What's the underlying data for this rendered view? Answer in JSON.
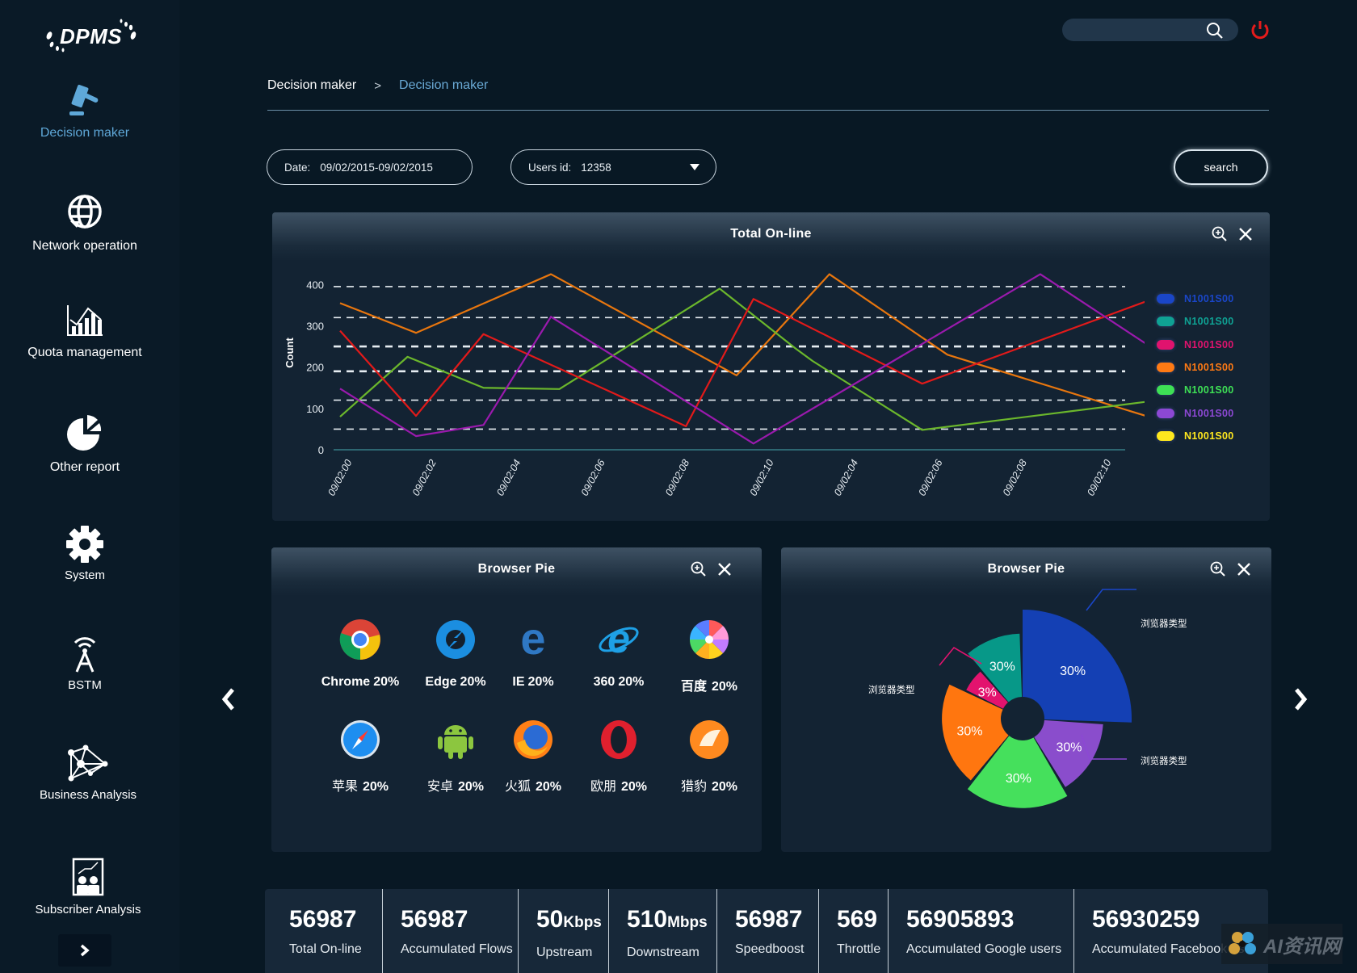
{
  "app": {
    "logo": "DPMS"
  },
  "sidebar": {
    "items": [
      {
        "label": "Decision maker",
        "icon": "gavel-icon",
        "active": true
      },
      {
        "label": "Network operation",
        "icon": "globe-refresh-icon"
      },
      {
        "label": "Quota management",
        "icon": "bar-chart-trend-icon"
      },
      {
        "label": "Other report",
        "icon": "pie-chart-icon"
      },
      {
        "label": "System",
        "icon": "gear-icon"
      },
      {
        "label": "BSTM",
        "icon": "antenna-tower-icon"
      },
      {
        "label": "Business Analysis",
        "icon": "network-graph-icon"
      },
      {
        "label": "Subscriber Analysis",
        "icon": "presentation-users-icon"
      }
    ],
    "more_icon": "chevron-right-icon"
  },
  "header": {
    "search_placeholder": "",
    "search_icon": "search-icon",
    "power_icon": "power-icon"
  },
  "breadcrumb": {
    "parent": "Decision maker",
    "separator": ">",
    "current": "Decision maker"
  },
  "filters": {
    "date_label": "Date:",
    "date_value": "09/02/2015-09/02/2015",
    "user_label": "Users id:",
    "user_value": "12358",
    "search_button": "search"
  },
  "line_panel": {
    "title": "Total On-line",
    "zoom_icon": "zoom-in-icon",
    "close_icon": "close-icon"
  },
  "pie_left": {
    "title": "Browser Pie",
    "browsers": [
      {
        "name": "Chrome",
        "pct": "20%",
        "icon": "chrome-icon"
      },
      {
        "name": "Edge",
        "pct": "20%",
        "icon": "edge-icon"
      },
      {
        "name": "IE",
        "pct": "20%",
        "icon": "ie-icon"
      },
      {
        "name": "360",
        "pct": "20%",
        "icon": "360-browser-icon"
      },
      {
        "name": "百度",
        "pct": "20%",
        "icon": "baidu-browser-icon"
      },
      {
        "name": "苹果",
        "pct": "20%",
        "icon": "safari-icon"
      },
      {
        "name": "安卓",
        "pct": "20%",
        "icon": "android-icon"
      },
      {
        "name": "火狐",
        "pct": "20%",
        "icon": "firefox-icon"
      },
      {
        "name": "欧朋",
        "pct": "20%",
        "icon": "opera-icon"
      },
      {
        "name": "猎豹",
        "pct": "20%",
        "icon": "cheetah-browser-icon"
      }
    ]
  },
  "pie_right": {
    "title": "Browser Pie"
  },
  "nav_arrows": {
    "prev": "chevron-left-icon",
    "next": "chevron-right-icon"
  },
  "stats": [
    {
      "value": "56987",
      "unit": "",
      "label": "Total On-line"
    },
    {
      "value": "56987",
      "unit": "",
      "label": "Accumulated Flows"
    },
    {
      "value": "50",
      "unit": "Kbps",
      "label": "Upstream"
    },
    {
      "value": "510",
      "unit": "Mbps",
      "label": "Downstream"
    },
    {
      "value": "56987",
      "unit": "",
      "label": "Speedboost"
    },
    {
      "value": "569",
      "unit": "",
      "label": "Throttle"
    },
    {
      "value": "56905893",
      "unit": "",
      "label": "Accumulated Google users"
    },
    {
      "value": "56930259",
      "unit": "",
      "label": "Accumulated Facebook user"
    }
  ],
  "watermark": "AI资讯网",
  "chart_data": [
    {
      "type": "line",
      "title": "Total On-line",
      "xlabel": "",
      "ylabel": "Count",
      "ylim": [
        0,
        430
      ],
      "yticks": [
        0,
        100,
        200,
        300,
        400
      ],
      "grid": true,
      "legend_position": "right",
      "categories": [
        "09/02:00",
        "09/02:02",
        "09/02:04",
        "09/02:06",
        "09/02:08",
        "09/02:10",
        "09/02:04",
        "09/02:06",
        "09/02:08",
        "09/02:10"
      ],
      "legend": [
        {
          "name": "N1001S00",
          "color": "#1a46c8"
        },
        {
          "name": "N1001S00",
          "color": "#0fa294"
        },
        {
          "name": "N1001S00",
          "color": "#e0136e"
        },
        {
          "name": "N1001S00",
          "color": "#ff7a14"
        },
        {
          "name": "N1001S00",
          "color": "#3ee055"
        },
        {
          "name": "N1001S00",
          "color": "#8c48d4"
        },
        {
          "name": "N1001S00",
          "color": "#ffe81e"
        }
      ],
      "series": [
        {
          "name": "orange",
          "color": "#e8760e",
          "x": [
            0,
            0.9,
            2.5,
            4.7,
            5.8,
            7.2,
            9.9
          ],
          "y": [
            355,
            283,
            425,
            180,
            425,
            230,
            60
          ]
        },
        {
          "name": "green",
          "color": "#6bb72c",
          "x": [
            0,
            0.8,
            1.7,
            2.6,
            4.5,
            5.4,
            5.6,
            6.9,
            9.9
          ],
          "y": [
            80,
            225,
            150,
            147,
            390,
            245,
            215,
            48,
            125
          ]
        },
        {
          "name": "red",
          "color": "#e21a1a",
          "x": [
            0,
            0.9,
            1.7,
            4.1,
            4.9,
            6.9,
            9.9
          ],
          "y": [
            288,
            82,
            280,
            57,
            365,
            160,
            385
          ]
        },
        {
          "name": "purple",
          "color": "#9a1aad",
          "x": [
            0,
            0.9,
            1.7,
            2.5,
            4.9,
            8.3,
            9.9
          ],
          "y": [
            148,
            33,
            60,
            322,
            15,
            425,
            210
          ]
        }
      ]
    },
    {
      "type": "pie",
      "title": "Browser Pie",
      "style": "rose-donut",
      "slices": [
        {
          "label": "30%",
          "value": 30,
          "color": "#1440b4",
          "radius_rel": 1.0
        },
        {
          "label": "30%",
          "value": 30,
          "color": "#8a4dcc",
          "radius_rel": 0.74
        },
        {
          "label": "30%",
          "value": 30,
          "color": "#45e05c",
          "radius_rel": 0.82
        },
        {
          "label": "30%",
          "value": 30,
          "color": "#ff760f",
          "radius_rel": 0.74
        },
        {
          "label": "3%",
          "value": 3,
          "color": "#e3136e",
          "radius_rel": 0.58
        },
        {
          "label": "30%",
          "value": 30,
          "color": "#079888",
          "radius_rel": 0.78
        }
      ],
      "callouts": [
        "浏览器类型",
        "浏览器类型",
        "浏览器类型"
      ]
    }
  ]
}
